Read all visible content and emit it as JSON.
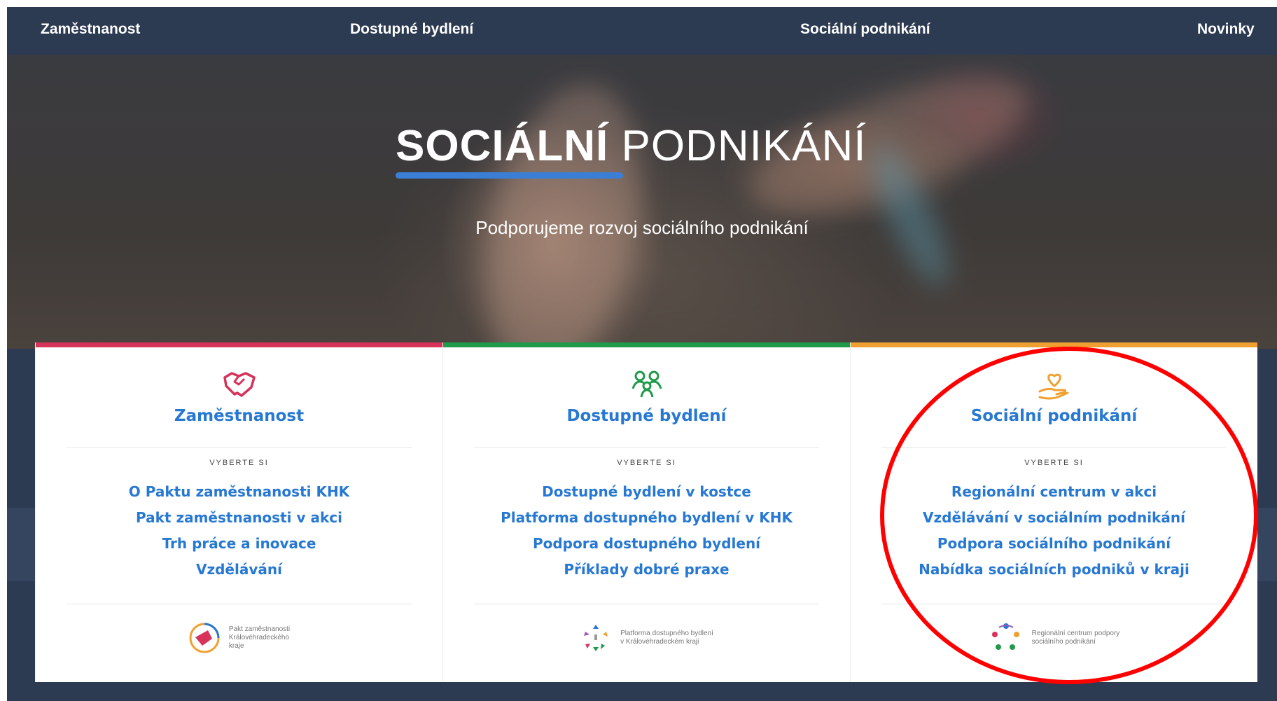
{
  "nav": {
    "items": [
      {
        "label": "Zaměstnanost"
      },
      {
        "label": "Dostupné bydlení"
      },
      {
        "label": "Sociální podnikání"
      },
      {
        "label": "Novinky"
      }
    ]
  },
  "hero": {
    "title_strong": "SOCIÁLNÍ",
    "title_thin": " PODNIKÁNÍ",
    "subtitle": "Podporujeme rozvoj sociálního podnikání",
    "accent_color": "#3a7fd5"
  },
  "cards": [
    {
      "title": "Zaměstnanost",
      "accent_color": "#d6325a",
      "icon": "handshake-icon",
      "kicker": "VYBERTE SI",
      "links": [
        "O Paktu zaměstnanosti KHK",
        "Pakt zaměstnanosti v akci",
        "Trh práce a inovace",
        "Vzdělávání"
      ],
      "logo_text": "Pakt zaměstnanosti\nKrálovéhradeckého\nkraje"
    },
    {
      "title": "Dostupné bydlení",
      "accent_color": "#1e9a4a",
      "icon": "people-icon",
      "kicker": "VYBERTE SI",
      "links": [
        "Dostupné bydlení v kostce",
        "Platforma dostupného bydlení v KHK",
        "Podpora dostupného bydlení",
        "Příklady dobré praxe"
      ],
      "logo_text": "Platforma dostupného bydlení\nv Královéhradeckém kraji"
    },
    {
      "title": "Sociální podnikání",
      "accent_color": "#f0a030",
      "icon": "heart-hand-icon",
      "kicker": "VYBERTE SI",
      "links": [
        "Regionální centrum v akci",
        "Vzdělávání v sociálním podnikání",
        "Podpora sociálního podnikání",
        "Nabídka sociálních podniků v kraji"
      ],
      "logo_text": "Regionální centrum podpory\nsociálního podnikání"
    }
  ],
  "annotation": {
    "highlight_color": "#ff0000"
  }
}
